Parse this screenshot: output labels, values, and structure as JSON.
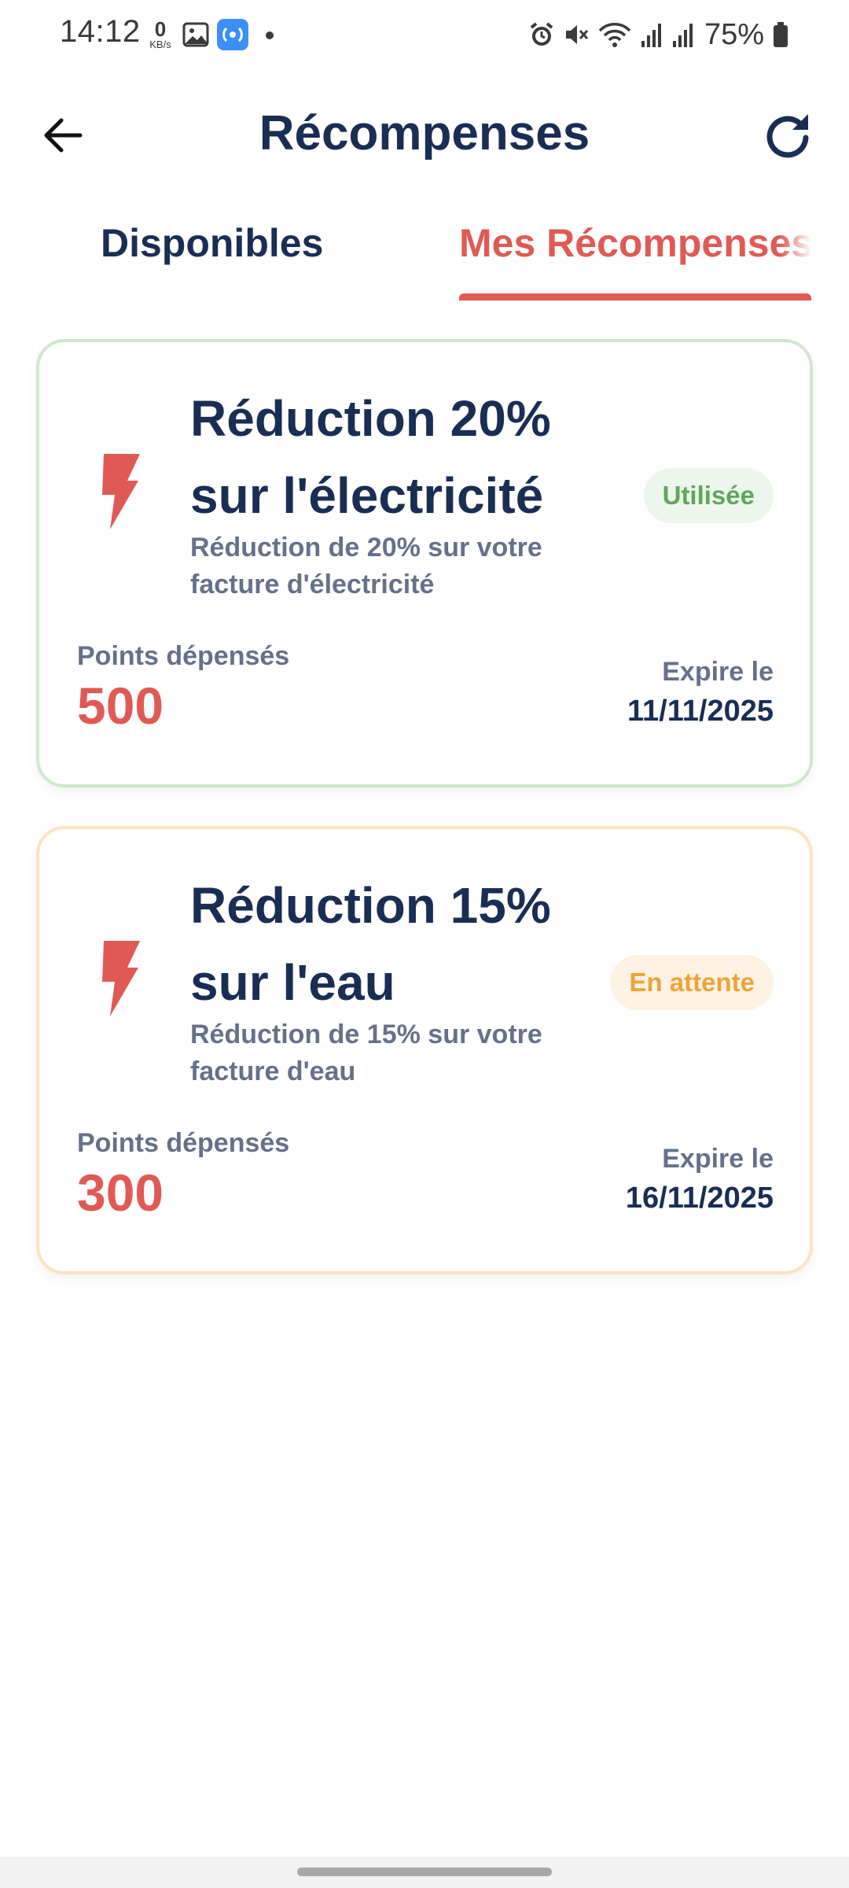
{
  "status_bar": {
    "time": "14:12",
    "speed_value": "0",
    "speed_unit": "KB/s",
    "battery": "75%"
  },
  "header": {
    "title": "Récompenses",
    "back_icon": "arrow-left-icon",
    "refresh_icon": "refresh-icon"
  },
  "tabs": [
    {
      "label": "Disponibles",
      "selected": false
    },
    {
      "label": "Mes Récompenses",
      "selected": true
    }
  ],
  "rewards": [
    {
      "icon": "lightning-bolt-icon",
      "title": "Réduction 20% sur l'électricité",
      "description": "Réduction de 20% sur votre facture d'électricité",
      "status": "Utilisée",
      "status_color": "#5ea85b",
      "points_label": "Points dépensés",
      "points": "500",
      "expire_label": "Expire le",
      "expire_date": "11/11/2025"
    },
    {
      "icon": "lightning-bolt-icon",
      "title": "Réduction 15% sur l'eau",
      "description": "Réduction de 15% sur votre facture d'eau",
      "status": "En attente",
      "status_color": "#eca43a",
      "points_label": "Points dépensés",
      "points": "300",
      "expire_label": "Expire le",
      "expire_date": "16/11/2025"
    }
  ],
  "colors": {
    "primary": "#1a2e54",
    "accent": "#e05a55",
    "muted": "#667189"
  }
}
